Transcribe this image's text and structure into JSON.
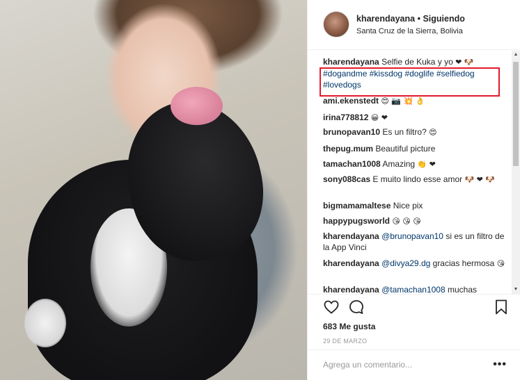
{
  "post": {
    "username": "kharendayana",
    "separator": "•",
    "follow_status": "Siguiendo",
    "location": "Santa Cruz de la Sierra, Bolivia"
  },
  "caption": {
    "user": "kharendayana",
    "text": "Selfie de Kuka y yo",
    "emoji": "❤ 🐶",
    "hashtags": [
      "#dogandme",
      "#kissdog",
      "#doglife",
      "#selfiedog",
      "#lovedogs"
    ]
  },
  "comments": [
    {
      "user": "ami.ekenstedt",
      "text": "",
      "emoji": "😍 📷 💥 👌"
    },
    {
      "user": "irina778812",
      "text": "",
      "emoji": "😀 ❤"
    },
    {
      "user": "brunopavan10",
      "text": "Es un filtro?",
      "emoji": "😍"
    },
    {
      "user": "thepug.mum",
      "text": "Beautiful picture",
      "emoji": ""
    },
    {
      "user": "tamachan1008",
      "text": "Amazing",
      "emoji": "👏 ❤"
    },
    {
      "user": "sony088cas",
      "text": "E muito lindo esse amor",
      "emoji": "🐶 ❤ 🐶"
    },
    {
      "user": "bigmamamaltese",
      "text": "Nice pix",
      "emoji": ""
    },
    {
      "user": "happypugsworld",
      "text": "",
      "emoji": "😘 😘 😘"
    },
    {
      "user": "kharendayana",
      "mention": "@brunopavan10",
      "text": "si es un filtro de la App Vinci",
      "emoji": ""
    },
    {
      "user": "kharendayana",
      "mention": "@divya29.dg",
      "text": "gracias hermosa",
      "emoji": "😘"
    },
    {
      "user": "kharendayana",
      "mention": "@tamachan1008",
      "text": "muchas",
      "emoji": ""
    }
  ],
  "actions": {
    "likes": "683 Me gusta",
    "date": "29 DE MARZO"
  },
  "add_comment": {
    "placeholder": "Agrega un comentario...",
    "more": "•••"
  },
  "icons": {
    "like": "heart-icon",
    "comment": "comment-bubble-icon",
    "save": "bookmark-icon",
    "more": "more-options-icon"
  },
  "colors": {
    "link": "#003569",
    "highlight_box": "#e3192a",
    "heart": "#e0245e"
  }
}
